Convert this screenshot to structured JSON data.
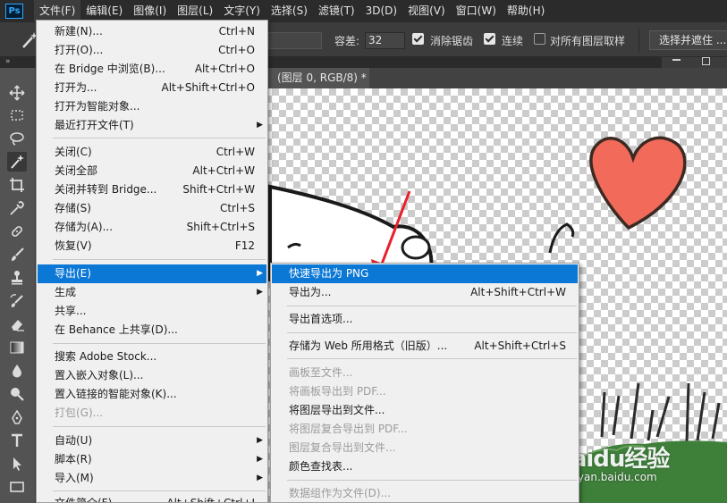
{
  "app": {
    "logo": "Ps"
  },
  "menubar": {
    "items": [
      {
        "label": "文件(F)"
      },
      {
        "label": "编辑(E)"
      },
      {
        "label": "图像(I)"
      },
      {
        "label": "图层(L)"
      },
      {
        "label": "文字(Y)"
      },
      {
        "label": "选择(S)"
      },
      {
        "label": "滤镜(T)"
      },
      {
        "label": "3D(D)"
      },
      {
        "label": "视图(V)"
      },
      {
        "label": "窗口(W)"
      },
      {
        "label": "帮助(H)"
      }
    ]
  },
  "options": {
    "tolerance_label": "容差:",
    "tolerance_value": "32",
    "antialias_label": "消除锯齿",
    "antialias_checked": true,
    "contiguous_label": "连续",
    "contiguous_checked": true,
    "sample_all_label": "对所有图层取样",
    "sample_all_checked": false,
    "select_mask_label": "选择并遮住 ..."
  },
  "panel_strip": {
    "collapse": "»"
  },
  "document": {
    "tab_title": "(图层 0, RGB/8) *"
  },
  "toolbar": {
    "tools": [
      "move-icon",
      "marquee-icon",
      "lasso-icon",
      "magic-wand-icon",
      "crop-icon",
      "eyedropper-icon",
      "healing-icon",
      "brush-icon",
      "stamp-icon",
      "history-brush-icon",
      "eraser-icon",
      "gradient-icon",
      "blur-icon",
      "dodge-icon",
      "pen-icon",
      "type-icon",
      "path-select-icon",
      "rectangle-icon"
    ],
    "active": "magic-wand-icon"
  },
  "file_menu": {
    "items": [
      {
        "label": "新建(N)...",
        "shortcut": "Ctrl+N"
      },
      {
        "label": "打开(O)...",
        "shortcut": "Ctrl+O"
      },
      {
        "label": "在 Bridge 中浏览(B)...",
        "shortcut": "Alt+Ctrl+O"
      },
      {
        "label": "打开为...",
        "shortcut": "Alt+Shift+Ctrl+O"
      },
      {
        "label": "打开为智能对象..."
      },
      {
        "label": "最近打开文件(T)",
        "submenu": true
      },
      {
        "label": "关闭(C)",
        "shortcut": "Ctrl+W"
      },
      {
        "label": "关闭全部",
        "shortcut": "Alt+Ctrl+W"
      },
      {
        "label": "关闭并转到 Bridge...",
        "shortcut": "Shift+Ctrl+W"
      },
      {
        "label": "存储(S)",
        "shortcut": "Ctrl+S"
      },
      {
        "label": "存储为(A)...",
        "shortcut": "Shift+Ctrl+S"
      },
      {
        "label": "恢复(V)",
        "shortcut": "F12"
      },
      {
        "label": "导出(E)",
        "submenu": true,
        "highlighted": true
      },
      {
        "label": "生成",
        "submenu": true
      },
      {
        "label": "共享..."
      },
      {
        "label": "在 Behance 上共享(D)..."
      },
      {
        "label": "搜索 Adobe Stock..."
      },
      {
        "label": "置入嵌入对象(L)..."
      },
      {
        "label": "置入链接的智能对象(K)..."
      },
      {
        "label": "打包(G)...",
        "disabled": true
      },
      {
        "label": "自动(U)",
        "submenu": true
      },
      {
        "label": "脚本(R)",
        "submenu": true
      },
      {
        "label": "导入(M)",
        "submenu": true
      },
      {
        "label": "文件简介(F)...",
        "shortcut": "Alt+Shift+Ctrl+I"
      }
    ]
  },
  "export_menu": {
    "items": [
      {
        "label": "快速导出为 PNG",
        "highlighted": true
      },
      {
        "label": "导出为...",
        "shortcut": "Alt+Shift+Ctrl+W"
      },
      {
        "label": "导出首选项..."
      },
      {
        "label": "存储为 Web 所用格式（旧版）...",
        "shortcut": "Alt+Shift+Ctrl+S"
      },
      {
        "label": "画板至文件...",
        "disabled": true
      },
      {
        "label": "将画板导出到 PDF...",
        "disabled": true
      },
      {
        "label": "将图层导出到文件..."
      },
      {
        "label": "将图层复合导出到 PDF...",
        "disabled": true
      },
      {
        "label": "图层复合导出到文件...",
        "disabled": true
      },
      {
        "label": "颜色查找表..."
      },
      {
        "label": "数据组作为文件(D)...",
        "disabled": true
      }
    ]
  },
  "watermark": {
    "logo": "Baidu经验",
    "url": "jingyan.baidu.com"
  },
  "colors": {
    "highlight": "#0c78d6",
    "menu_bg": "#f0f0f0",
    "heart": "#f26a5a",
    "annotation": "#e8202a"
  }
}
